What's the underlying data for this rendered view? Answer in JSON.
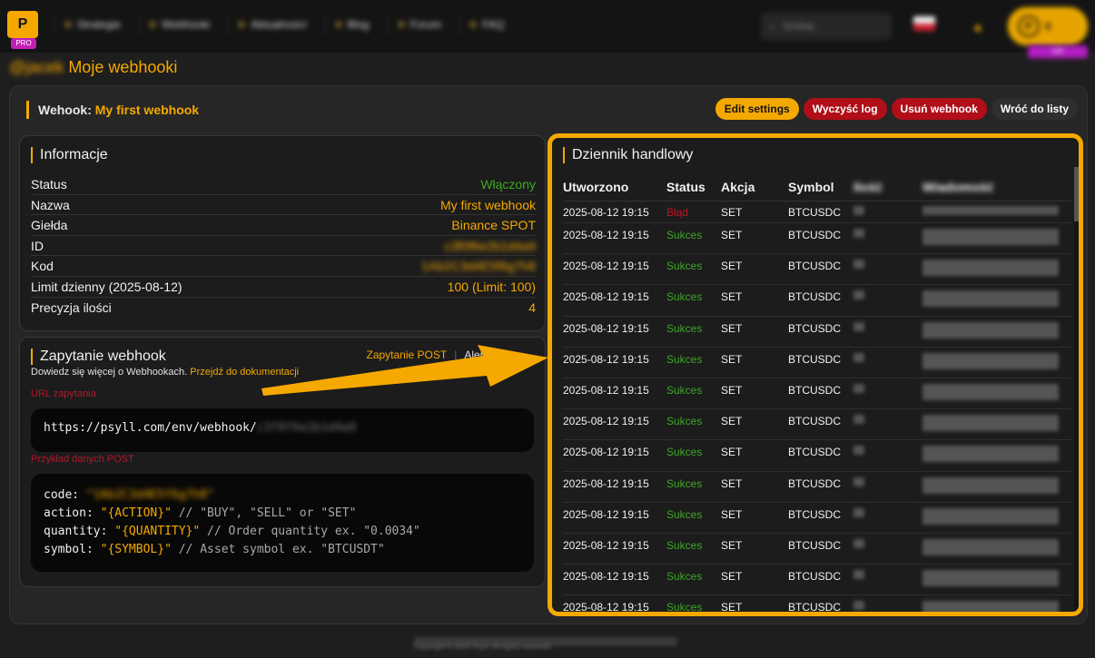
{
  "nav": {
    "logo_text": "P",
    "logo_badge": "PRO",
    "items": [
      {
        "label": "Strategie"
      },
      {
        "label": "Webhooki"
      },
      {
        "label": "Aktualności"
      },
      {
        "label": "Blog"
      },
      {
        "label": "Forum"
      },
      {
        "label": "FAQ"
      }
    ],
    "search_placeholder": "Szukaj...",
    "bell_icon": "bell-icon",
    "credits_value": "0",
    "credits_coin": "P",
    "credits_badge": "VIP"
  },
  "page": {
    "user": "@jacek",
    "title": "Moje webhooki"
  },
  "header": {
    "prefix": "Wehook:",
    "name": "My first webhook"
  },
  "actions": {
    "edit": "Edit settings",
    "clear_log": "Wyczyść log",
    "delete": "Usuń webhook",
    "back": "Wróć do listy"
  },
  "info": {
    "title": "Informacje",
    "rows": [
      {
        "label": "Status",
        "value": "Włączony"
      },
      {
        "label": "Nazwa",
        "value": "My first webhook"
      },
      {
        "label": "Giełda",
        "value": "Binance SPOT"
      },
      {
        "label": "ID",
        "value": "c3f0f6e2b1d4a9"
      },
      {
        "label": "Kod",
        "value": "1Ab2C3d4E5f6g7h8"
      },
      {
        "label": "Limit dzienny (2025-08-12)",
        "value": "100 (Limit: 100)"
      },
      {
        "label": "Precyzja ilości",
        "value": "4"
      }
    ]
  },
  "request": {
    "title": "Zapytanie webhook",
    "tab_post": "Zapytanie POST",
    "tab_sep": "|",
    "tab_alert": "Alert Tr",
    "desc": "Dowiedz się więcej o Webhookach.",
    "desc_link": "Przejdź do dokumentacji",
    "url_label": "URL zapytania",
    "url": "https://psyll.com/env/webhook/",
    "url_hidden": "c3f0f6e2b1d4a9",
    "post_label": "Przykład danych POST",
    "code_key": "code:",
    "code_val": "\"1Ab2C3d4E5f6g7h8\"",
    "action_key": "action:",
    "action_val": "\"{ACTION}\"",
    "action_cmt": "// \"BUY\", \"SELL\" or \"SET\"",
    "qty_key": "quantity:",
    "qty_val": "\"{QUANTITY}\"",
    "qty_cmt": "// Order quantity ex. \"0.0034\"",
    "sym_key": "symbol:",
    "sym_val": "\"{SYMBOL}\"",
    "sym_cmt": "// Asset symbol ex. \"BTCUSDT\""
  },
  "log": {
    "title": "Dziennik handlowy",
    "columns": [
      "Utworzono",
      "Status",
      "Akcja",
      "Symbol",
      "Ilość",
      "Wiadomość"
    ],
    "rows": [
      {
        "date": "2025-08-12 19:15",
        "status": "Błąd",
        "action": "SET",
        "symbol": "BTCUSDC"
      },
      {
        "date": "2025-08-12 19:15",
        "status": "Sukces",
        "action": "SET",
        "symbol": "BTCUSDC"
      },
      {
        "date": "2025-08-12 19:15",
        "status": "Sukces",
        "action": "SET",
        "symbol": "BTCUSDC"
      },
      {
        "date": "2025-08-12 19:15",
        "status": "Sukces",
        "action": "SET",
        "symbol": "BTCUSDC"
      },
      {
        "date": "2025-08-12 19:15",
        "status": "Sukces",
        "action": "SET",
        "symbol": "BTCUSDC"
      },
      {
        "date": "2025-08-12 19:15",
        "status": "Sukces",
        "action": "SET",
        "symbol": "BTCUSDC"
      },
      {
        "date": "2025-08-12 19:15",
        "status": "Sukces",
        "action": "SET",
        "symbol": "BTCUSDC"
      },
      {
        "date": "2025-08-12 19:15",
        "status": "Sukces",
        "action": "SET",
        "symbol": "BTCUSDC"
      },
      {
        "date": "2025-08-12 19:15",
        "status": "Sukces",
        "action": "SET",
        "symbol": "BTCUSDC"
      },
      {
        "date": "2025-08-12 19:15",
        "status": "Sukces",
        "action": "SET",
        "symbol": "BTCUSDC"
      },
      {
        "date": "2025-08-12 19:15",
        "status": "Sukces",
        "action": "SET",
        "symbol": "BTCUSDC"
      },
      {
        "date": "2025-08-12 19:15",
        "status": "Sukces",
        "action": "SET",
        "symbol": "BTCUSDC"
      },
      {
        "date": "2025-08-12 19:15",
        "status": "Sukces",
        "action": "SET",
        "symbol": "BTCUSDC"
      },
      {
        "date": "2025-08-12 19:15",
        "status": "Sukces",
        "action": "SET",
        "symbol": "BTCUSDC"
      }
    ]
  },
  "colors": {
    "accent": "#f5a800",
    "success": "#3ca824",
    "error": "#c0141e",
    "danger_button": "#b00e18"
  },
  "footer": {
    "text": "Copyright © 2025 Psyll. All rights reserved."
  }
}
